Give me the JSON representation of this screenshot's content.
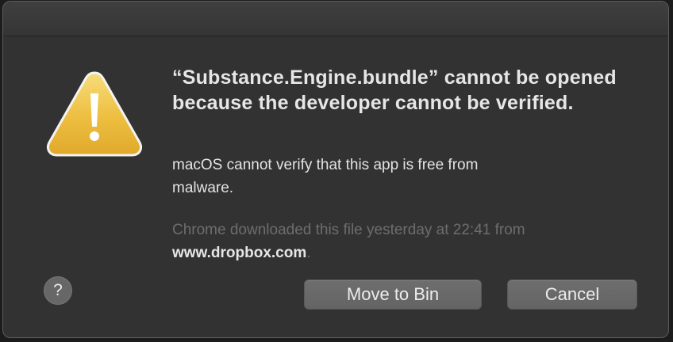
{
  "dialog": {
    "title": "“Substance.Engine.bundle” cannot be opened because the developer cannot be verified.",
    "message": "macOS cannot verify that this app is free from malware.",
    "source_prefix": "Chrome downloaded this file yesterday at 22:41 from",
    "source_domain": "www.dropbox.com",
    "source_suffix": "."
  },
  "buttons": {
    "help": "?",
    "move_to_bin": "Move to Bin",
    "cancel": "Cancel"
  },
  "icons": {
    "warning": "warning-triangle-icon"
  },
  "colors": {
    "warning_fill": "#f0c64a",
    "background": "#323232",
    "button": "#676767"
  }
}
